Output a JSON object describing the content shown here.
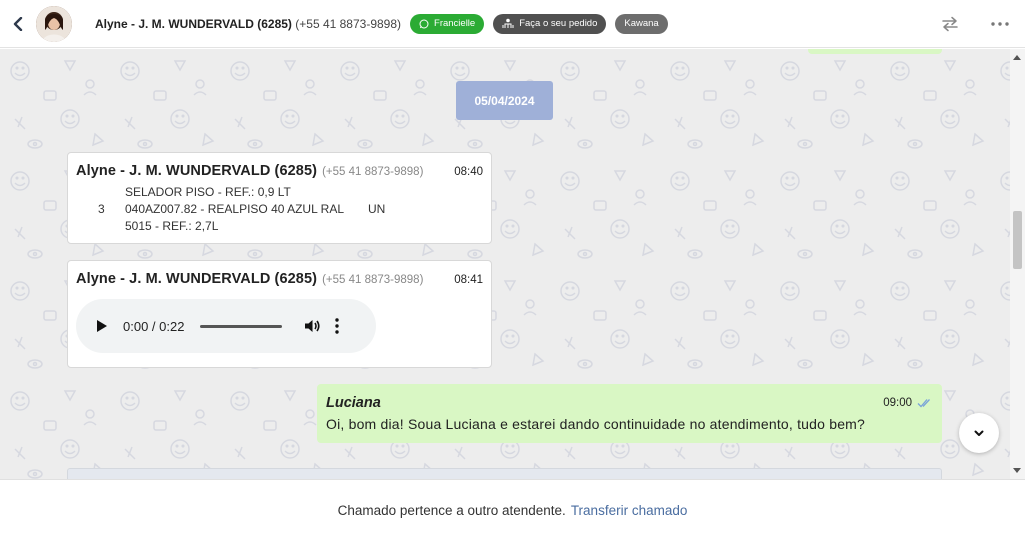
{
  "header": {
    "contact_name": "Alyne - J. M. WUNDERVALD (6285)",
    "contact_phone": "(+55 41 8873-9898)",
    "tags": [
      {
        "label": "Francielle",
        "color": "#2bab34",
        "icon": "whatsapp-icon"
      },
      {
        "label": "Faça o seu pedido",
        "color": "#505050",
        "icon": "people-icon"
      },
      {
        "label": "Kawana",
        "color": "#6d6d6d"
      }
    ]
  },
  "chat": {
    "date_badge": "05/04/2024",
    "messages": [
      {
        "sender": "Alyne - J. M. WUNDERVALD (6285)",
        "phone": "(+55 41 8873-9898)",
        "time": "08:40",
        "image_lines": {
          "line1": "SELADOR PISO - REF.: 0,9 LT",
          "qty": "3",
          "line2": "040AZ007.82 - REALPISO 40 AZUL RAL",
          "unit": "UN",
          "line3": "5015 - REF.: 2,7L"
        }
      },
      {
        "sender": "Alyne - J. M. WUNDERVALD (6285)",
        "phone": "(+55 41 8873-9898)",
        "time": "08:41",
        "audio_time": "0:00 / 0:22"
      },
      {
        "sender": "Luciana",
        "time": "09:00",
        "text": "Oi, bom dia! Soua Luciana e estarei dando continuidade no atendimento, tudo bem?"
      }
    ]
  },
  "footer": {
    "notice": "Chamado pertence a outro atendente.",
    "transfer_link": "Transferir chamado"
  },
  "colors": {
    "outgoing_bubble": "#d9f7c4",
    "date_badge": "#9fb0d8",
    "link": "#4a6da0"
  }
}
